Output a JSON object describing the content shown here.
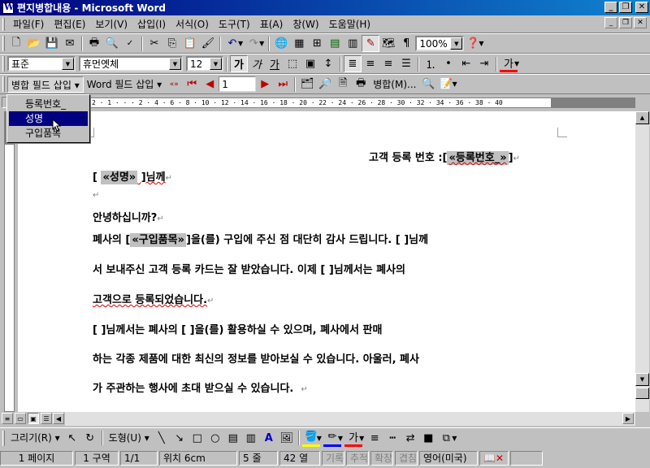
{
  "window": {
    "title": "편지병합내용 - Microsoft Word"
  },
  "menu": [
    "파일(F)",
    "편집(E)",
    "보기(V)",
    "삽입(I)",
    "서식(O)",
    "도구(T)",
    "표(A)",
    "창(W)",
    "도움말(H)"
  ],
  "toolbar_standard": {
    "zoom": "100%"
  },
  "toolbar_format": {
    "style": "표준",
    "font": "휴먼옛체",
    "size": "12",
    "bold": "가",
    "italic": "가",
    "underline": "가"
  },
  "mailmerge_bar": {
    "merge_field_btn": "병합 필드 삽입",
    "word_field_btn": "Word 필드 삽입",
    "record": "1",
    "merge_btn": "병합(M)..."
  },
  "merge_dropdown": {
    "items": [
      "등록번호_",
      "성명",
      "구입품목"
    ],
    "selected": "성명"
  },
  "ruler": {
    "numbers": "2 · 1 · · · 2 · 4 · 6 · 8 · 10 · 12 · 14 · 16 · 18 · 20 · 22 · 24 · 26 · 28 · 30 · 32 · 34 · 36 · 38 · 40"
  },
  "document": {
    "line1_prefix": "고객 등록 번호 :[",
    "line1_field": "«등록번호_»",
    "line1_suffix": "]",
    "line2_prefix": "[ ",
    "line2_field": "«성명»",
    "line2_suffix": " ]님께",
    "line4": "안녕하십니까?",
    "line5_a": "폐사의 [",
    "line5_field": "«구입품목»",
    "line5_b": "]을(를) 구입에 주신 점 대단히 감사 드립니다. [      ]님께",
    "line6": "서 보내주신 고객 등록 카드는 잘 받았습니다.  이제 [      ]님께서는 폐사의",
    "line7": "고객으로 등록되었습니다.",
    "line8": "[       ]님께서는 폐사의 [       ]을(를)  활용하실 수 있으며,  폐사에서 판매",
    "line9": "하는 각종 제품에 대한 최신의 정보를 받아보실 수 있습니다.  아울러, 폐사",
    "line10": "가 주관하는 행사에 초대 받으실 수 있습니다."
  },
  "drawing_bar": {
    "draw": "그리기(R)",
    "autoshape": "도형(U)"
  },
  "status": {
    "page": "1 페이지",
    "section": "1 구역",
    "pages": "1/1",
    "position": "위치 6cm",
    "line": "5 줄",
    "col": "42 열",
    "rec": "기록",
    "trk": "추적",
    "ext": "확장",
    "ovr": "겹침",
    "lang": "영어(미국)"
  }
}
